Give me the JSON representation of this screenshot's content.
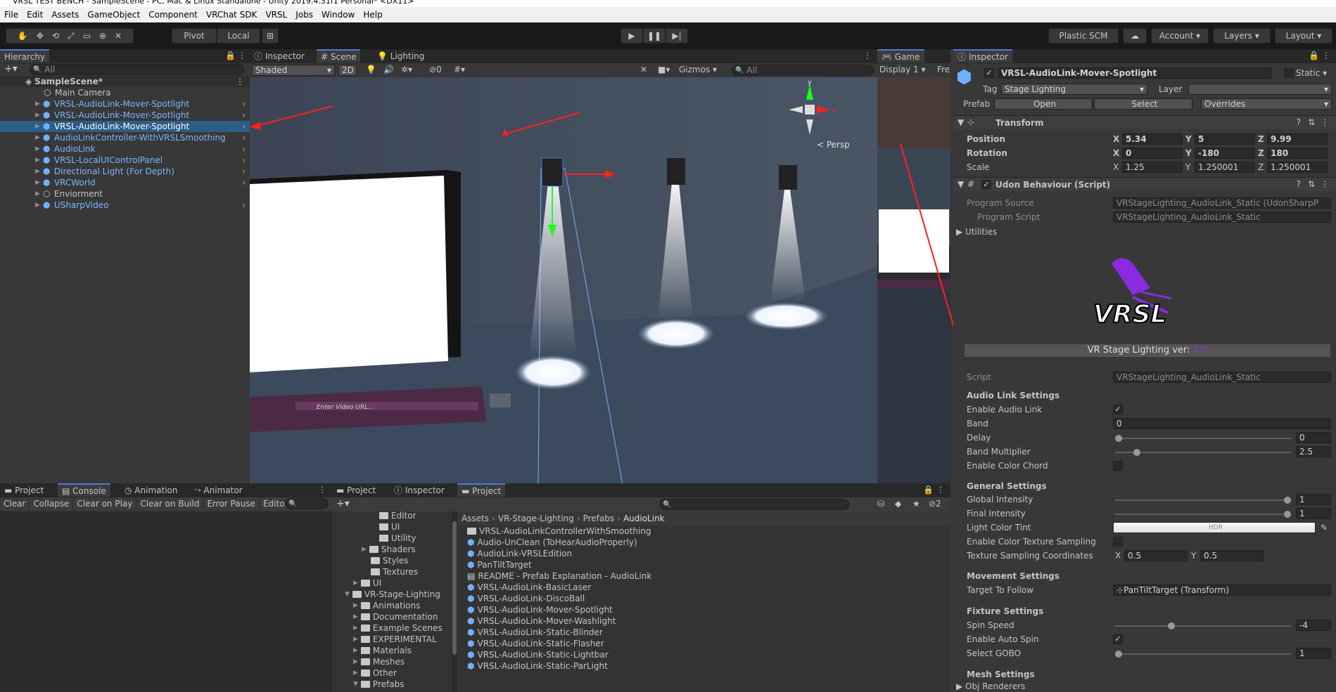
{
  "window_title": "VRSL TEST BENCH - SampleScene - PC, Mac & Linux Standalone - Unity 2019.4.31f1 Personal* <DX11>",
  "menu": [
    "File",
    "Edit",
    "Assets",
    "GameObject",
    "Component",
    "VRChat SDK",
    "VRSL",
    "Jobs",
    "Window",
    "Help"
  ],
  "toolbar": {
    "pivot": "Pivot",
    "local": "Local",
    "plastic": "Plastic SCM",
    "account": "Account",
    "layers": "Layers",
    "layout": "Layout"
  },
  "hierarchy": {
    "tab": "Hierarchy",
    "search_placeholder": "All",
    "scene": "SampleScene*",
    "items": [
      {
        "name": "Main Camera",
        "prefab": false,
        "selected": false
      },
      {
        "name": "VRSL-AudioLink-Mover-Spotlight",
        "prefab": true,
        "selected": false
      },
      {
        "name": "VRSL-AudioLink-Mover-Spotlight",
        "prefab": true,
        "selected": false
      },
      {
        "name": "VRSL-AudioLink-Mover-Spotlight",
        "prefab": true,
        "selected": true
      },
      {
        "name": "AudioLinkController-WithVRSLSmoothing",
        "prefab": true,
        "selected": false
      },
      {
        "name": "AudioLink",
        "prefab": true,
        "selected": false
      },
      {
        "name": "VRSL-LocalUIControlPanel",
        "prefab": true,
        "selected": false
      },
      {
        "name": "Directional Light (For Depth)",
        "prefab": true,
        "selected": false
      },
      {
        "name": "VRCWorld",
        "prefab": true,
        "selected": false
      },
      {
        "name": "Enviorment",
        "prefab": false,
        "selected": false
      },
      {
        "name": "USharpVideo",
        "prefab": true,
        "selected": false
      }
    ]
  },
  "scene_tabs": {
    "inspector": "Inspector",
    "scene": "Scene",
    "lighting": "Lighting",
    "shaded": "Shaded",
    "two_d": "2D",
    "gizmos": "Gizmos",
    "search": "All",
    "hidden_count": "0",
    "persp": "< Persp",
    "video_url": "Enter Video URL..."
  },
  "game_tabs": {
    "game": "Game",
    "display": "Display 1",
    "free": "Fre"
  },
  "inspector": {
    "tab": "Inspector",
    "object_name": "VRSL-AudioLink-Mover-Spotlight",
    "static": "Static",
    "tag_label": "Tag",
    "tag": "Stage Lighting",
    "layer_label": "Layer",
    "layer": "",
    "prefab_label": "Prefab",
    "open": "Open",
    "select": "Select",
    "overrides": "Overrides",
    "transform": {
      "title": "Transform",
      "position": "Position",
      "rotation": "Rotation",
      "scale": "Scale",
      "pos": [
        "5.34",
        "5",
        "9.99"
      ],
      "rot": [
        "0",
        "-180",
        "180"
      ],
      "scl": [
        "1.25",
        "1.250001",
        "1.250001"
      ]
    },
    "udon": {
      "title": "Udon Behaviour (Script)",
      "program_source_label": "Program Source",
      "program_source": "VRStageLighting_AudioLink_Static (UdonSharpP",
      "program_script_label": "Program Script",
      "program_script": "VRStageLighting_AudioLink_Static",
      "utilities": "Utilities"
    },
    "logo_text": "VRSL",
    "version_label": "VR Stage Lighting ver:",
    "version": "2.0",
    "script_label": "Script",
    "script_value": "VRStageLighting_AudioLink_Static",
    "audio_link": {
      "title": "Audio Link Settings",
      "enable": "Enable Audio Link",
      "band": "Band",
      "band_value": "0",
      "delay": "Delay",
      "delay_value": "0",
      "band_mult": "Band Multiplier",
      "band_mult_value": "2.5",
      "color_chord": "Enable Color Chord"
    },
    "general": {
      "title": "General Settings",
      "global": "Global Intensity",
      "global_value": "1",
      "final": "Final Intensity",
      "final_value": "1",
      "tint": "Light Color Tint",
      "hdr": "HDR",
      "tex_sampling": "Enable Color Texture Sampling",
      "tex_coords": "Texture Sampling Coordinates",
      "tex_x": "0.5",
      "tex_y": "0.5"
    },
    "movement": {
      "title": "Movement Settings",
      "target": "Target To Follow",
      "target_value": "PanTiltTarget (Transform)"
    },
    "fixture": {
      "title": "Fixture Settings",
      "spin": "Spin Speed",
      "spin_value": "-4",
      "auto_spin": "Enable Auto Spin",
      "gobo": "Select GOBO",
      "gobo_value": "1"
    },
    "mesh": {
      "title": "Mesh Settings",
      "renderers": "Obj Renderers"
    }
  },
  "bottom_left": {
    "tabs": [
      "Project",
      "Console",
      "Animation",
      "Animator"
    ],
    "buttons": [
      "Clear",
      "Collapse",
      "Clear on Play",
      "Clear on Build",
      "Error Pause",
      "Editor"
    ]
  },
  "bottom_mid": {
    "tabs": [
      "Project",
      "Inspector",
      "Project"
    ],
    "hidden_count": "2",
    "tree": [
      {
        "name": "Editor",
        "indent": 3,
        "arrow": false
      },
      {
        "name": "UI",
        "indent": 3,
        "arrow": false
      },
      {
        "name": "Utility",
        "indent": 3,
        "arrow": false
      },
      {
        "name": "Shaders",
        "indent": 2,
        "arrow": true
      },
      {
        "name": "Styles",
        "indent": 2,
        "arrow": false
      },
      {
        "name": "Textures",
        "indent": 2,
        "arrow": false
      },
      {
        "name": "UI",
        "indent": 1,
        "arrow": true
      },
      {
        "name": "VR-Stage-Lighting",
        "indent": 0,
        "arrow": true
      },
      {
        "name": "Animations",
        "indent": 1,
        "arrow": true
      },
      {
        "name": "Documentation",
        "indent": 1,
        "arrow": true
      },
      {
        "name": "Example Scenes",
        "indent": 1,
        "arrow": true
      },
      {
        "name": "EXPERIMENTAL",
        "indent": 1,
        "arrow": true
      },
      {
        "name": "Materials",
        "indent": 1,
        "arrow": true
      },
      {
        "name": "Meshes",
        "indent": 1,
        "arrow": true
      },
      {
        "name": "Other",
        "indent": 1,
        "arrow": true
      },
      {
        "name": "Prefabs",
        "indent": 1,
        "arrow": true
      }
    ],
    "breadcrumb": [
      "Assets",
      "VR-Stage-Lighting",
      "Prefabs",
      "AudioLink"
    ],
    "files": [
      {
        "name": "VRSL-AudioLinkControllerWithSmoothing",
        "kind": "folder"
      },
      {
        "name": "Audio-UnClean (ToHearAudioProperly)",
        "kind": "prefab"
      },
      {
        "name": "AudioLink-VRSLEdition",
        "kind": "prefab"
      },
      {
        "name": "PanTiltTarget",
        "kind": "prefab"
      },
      {
        "name": "README - Prefab Explanation - AudioLink",
        "kind": "doc"
      },
      {
        "name": "VRSL-AudioLink-BasicLaser",
        "kind": "prefab"
      },
      {
        "name": "VRSL-AudioLink-DiscoBall",
        "kind": "prefab"
      },
      {
        "name": "VRSL-AudioLink-Mover-Spotlight",
        "kind": "prefab"
      },
      {
        "name": "VRSL-AudioLink-Mover-Washlight",
        "kind": "prefab"
      },
      {
        "name": "VRSL-AudioLink-Static-Blinder",
        "kind": "prefab"
      },
      {
        "name": "VRSL-AudioLink-Static-Flasher",
        "kind": "prefab"
      },
      {
        "name": "VRSL-AudioLink-Static-Lightbar",
        "kind": "prefab"
      },
      {
        "name": "VRSL-AudioLink-Static-ParLight",
        "kind": "prefab"
      }
    ]
  },
  "colors": {
    "accent": "#4b7bd9",
    "prefab_text": "#7cb6ff",
    "selection": "#2c5d87",
    "logo_purple": "#8a2be2",
    "arrow_red": "#ff2020"
  }
}
